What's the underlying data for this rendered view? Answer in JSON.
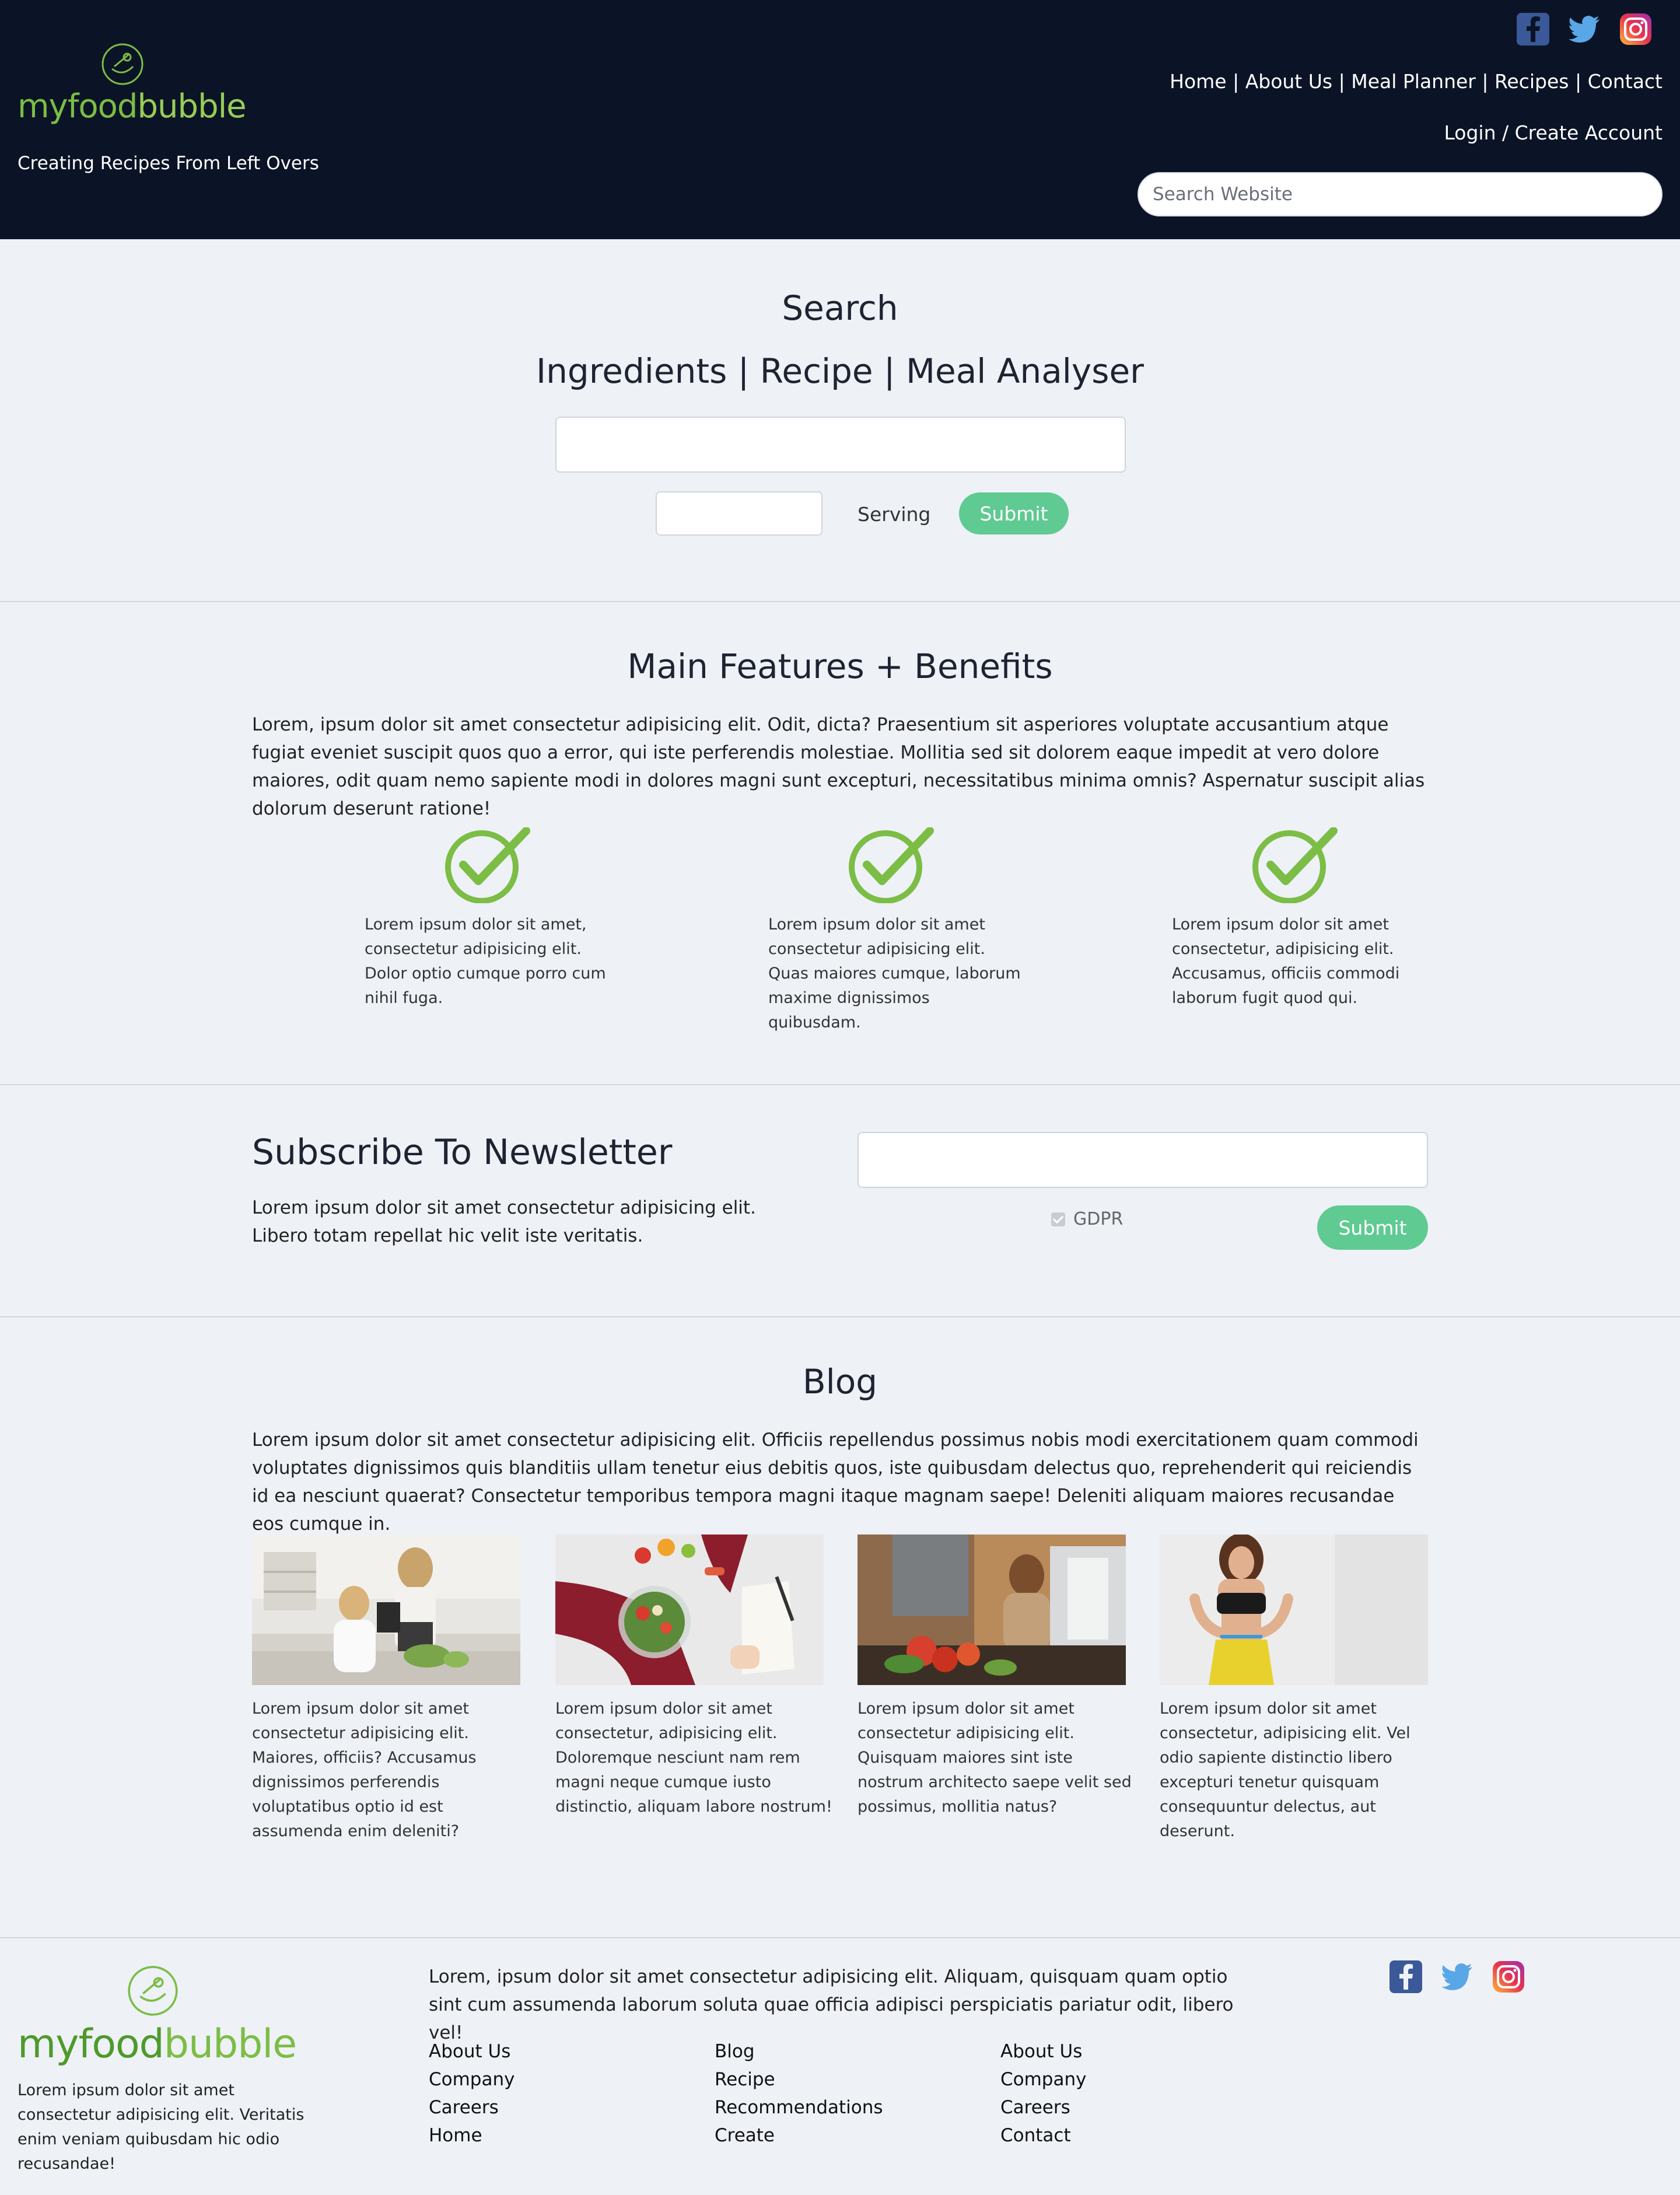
{
  "header": {
    "logo": {
      "part1": "myfood",
      "part2": "bubble"
    },
    "tagline": "Creating Recipes From Left Overs",
    "social_icons": [
      "facebook-icon",
      "twitter-icon",
      "instagram-icon"
    ],
    "nav": [
      "Home",
      "About Us",
      "Meal Planner",
      "Recipes",
      "Contact"
    ],
    "nav_separator": " | ",
    "login": "Login",
    "auth_separator": " / ",
    "create_account": "Create Account",
    "search_placeholder": "Search Website"
  },
  "search_section": {
    "title": "Search",
    "subtitle": "Ingredients | Recipe | Meal Analyser",
    "serving_label": "Serving",
    "submit_label": "Submit"
  },
  "features": {
    "title": "Main Features + Benefits",
    "intro": "Lorem, ipsum dolor sit amet consectetur adipisicing elit. Odit, dicta? Praesentium sit asperiores voluptate accusantium atque fugiat eveniet suscipit quos quo a error, qui iste perferendis molestiae. Mollitia sed sit dolorem eaque impedit at vero dolore maiores, odit quam nemo sapiente modi in dolores magni sunt excepturi, necessitatibus minima omnis? Aspernatur suscipit alias dolorum deserunt ratione!",
    "items": [
      {
        "icon": "checkmark-icon",
        "text": "Lorem ipsum dolor sit amet, consectetur adipisicing elit. Dolor optio cumque porro cum nihil fuga."
      },
      {
        "icon": "checkmark-icon",
        "text": "Lorem ipsum dolor sit amet consectetur adipisicing elit. Quas maiores cumque, laborum maxime dignissimos quibusdam."
      },
      {
        "icon": "checkmark-icon",
        "text": "Lorem ipsum dolor sit amet consectetur, adipisicing elit. Accusamus, officiis commodi laborum fugit quod qui."
      }
    ],
    "accent_color": "#7bbd45"
  },
  "newsletter": {
    "title": "Subscribe To Newsletter",
    "text": "Lorem ipsum dolor sit amet consectetur adipisicing elit. Libero totam repellat hic velit iste veritatis.",
    "gdpr_label": "GDPR",
    "gdpr_checked": true,
    "submit_label": "Submit"
  },
  "blog": {
    "title": "Blog",
    "intro": "Lorem ipsum dolor sit amet consectetur adipisicing elit. Officiis repellendus possimus nobis modi exercitationem quam commodi voluptates dignissimos quis blanditiis ullam tenetur eius debitis quos, iste quibusdam delectus quo, reprehenderit qui reiciendis id ea nesciunt quaerat? Consectetur temporibus tempora magni itaque magnam saepe! Deleniti aliquam maiores recusandae eos cumque in.",
    "posts": [
      {
        "image": "kitchen-women-photo",
        "text": "Lorem ipsum dolor sit amet consectetur adipisicing elit. Maiores, officiis? Accusamus dignissimos perferendis voluptatibus optio id est assumenda enim deleniti?"
      },
      {
        "image": "salad-bowl-photo",
        "text": "Lorem ipsum dolor sit amet consectetur, adipisicing elit. Doloremque nesciunt nam rem magni neque cumque iusto distinctio, aliquam labore nostrum!"
      },
      {
        "image": "cooking-woman-photo",
        "text": "Lorem ipsum dolor sit amet consectetur adipisicing elit. Quisquam maiores sint iste nostrum architecto saepe velit sed possimus, mollitia natus?"
      },
      {
        "image": "fitness-woman-photo",
        "text": "Lorem ipsum dolor sit amet consectetur, adipisicing elit. Vel odio sapiente distinctio libero excepturi tenetur quisquam consequuntur delectus, aut deserunt."
      }
    ]
  },
  "footer": {
    "logo": {
      "part1": "myfood",
      "part2": "bubble"
    },
    "description": "Lorem ipsum dolor sit amet consectetur adipisicing elit. Veritatis enim veniam quibusdam hic odio recusandae!",
    "text": "Lorem, ipsum dolor sit amet consectetur adipisicing elit. Aliquam, quisquam quam optio sint cum assumenda laborum soluta quae officia adipisci perspiciatis pariatur odit, libero vel!",
    "columns": [
      [
        "About Us",
        "Company",
        "Careers",
        "Home"
      ],
      [
        "Blog",
        "Recipe",
        "Recommendations",
        "Create"
      ],
      [
        "About Us",
        "Company",
        "Careers",
        "Contact"
      ]
    ],
    "social_icons": [
      "facebook-icon",
      "twitter-icon",
      "instagram-icon"
    ]
  },
  "colors": {
    "header_bg": "#0b1426",
    "page_bg": "#eef1f6",
    "button_green": "#5fca91",
    "logo_green": "#7bbd45",
    "facebook_blue": "#3b5998",
    "twitter_blue": "#5aa7e8"
  }
}
